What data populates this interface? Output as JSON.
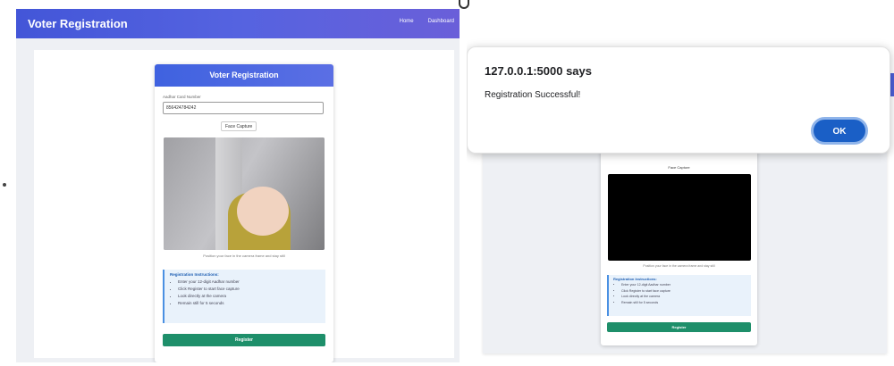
{
  "left": {
    "navbar": {
      "brand": "Voter Registration",
      "links": [
        "Home",
        "Dashboard"
      ]
    },
    "card": {
      "title": "Voter Registration",
      "aadhar_label": "Aadhar Card Number",
      "aadhar_value": "856424784242",
      "face_capture_label": "Face Capture",
      "hint": "Position your face in the camera frame and stay still",
      "instructions_title": "Registration Instructions:",
      "instructions": [
        "Enter your 12-digit Aadhar number",
        "Click Register to start face capture",
        "Look directly at the camera",
        "Remain still for 5 seconds"
      ],
      "register_label": "Register"
    }
  },
  "right": {
    "dialog": {
      "title": "127.0.0.1:5000 says",
      "message": "Registration Successful!",
      "ok_label": "OK"
    },
    "card": {
      "face_capture_label": "Face Capture",
      "hint": "Position your face in the camera frame and stay still",
      "instructions_title": "Registration Instructions:",
      "instructions": [
        "Enter your 12-digit Aadhar number",
        "Click Register to start face capture",
        "Look directly at the camera",
        "Remain still for 5 seconds"
      ],
      "register_label": "Register"
    }
  },
  "colors": {
    "navbar_gradient_start": "#4356d8",
    "header_blue": "#3f62e0",
    "register_green": "#1e8f6a",
    "ok_blue": "#1a5fc6",
    "instructions_bg": "#e9f2fb"
  }
}
